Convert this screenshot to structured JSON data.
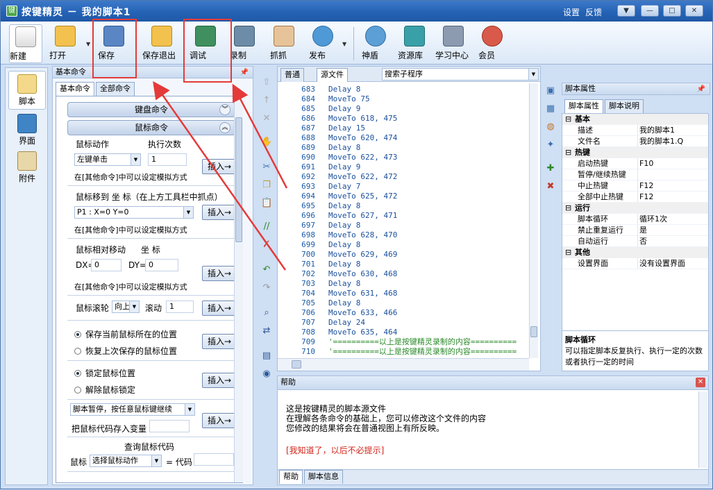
{
  "window": {
    "title": "按键精灵 － 我的脚本1",
    "links": [
      "设置",
      "反馈"
    ]
  },
  "toolbar": {
    "buttons": [
      {
        "label": "新建",
        "icon": "new-icon"
      },
      {
        "label": "打开",
        "icon": "open-icon"
      },
      {
        "label": "保存",
        "icon": "save-icon"
      },
      {
        "label": "保存退出",
        "icon": "save-exit-icon"
      },
      {
        "label": "调试",
        "icon": "debug-icon"
      },
      {
        "label": "录制",
        "icon": "record-icon"
      },
      {
        "label": "抓抓",
        "icon": "grab-icon"
      },
      {
        "label": "发布",
        "icon": "publish-icon"
      },
      {
        "label": "神盾",
        "icon": "shield-icon"
      },
      {
        "label": "资源库",
        "icon": "resource-icon"
      },
      {
        "label": "学习中心",
        "icon": "learning-icon"
      },
      {
        "label": "会员",
        "icon": "member-icon"
      }
    ]
  },
  "leftnav": [
    {
      "label": "脚本"
    },
    {
      "label": "界面"
    },
    {
      "label": "附件"
    }
  ],
  "cmdpanel": {
    "header": "基本命令",
    "tabs": [
      "基本命令",
      "全部命令"
    ],
    "groups": [
      "键盘命令",
      "鼠标命令"
    ],
    "mouse_action": {
      "label": "鼠标动作",
      "count_label": "执行次数",
      "action_value": "左键单击",
      "count_value": "1",
      "note": "在[其他命令]中可以设定模拟方式",
      "insert": "插入→"
    },
    "mouse_move": {
      "label": "鼠标移到 坐 标（在上方工具栏中抓点）",
      "value": "P1 : X=0 Y=0",
      "note": "在[其他命令]中可以设定模拟方式",
      "insert": "插入→"
    },
    "relative": {
      "label": "鼠标相对移动",
      "coord_label": "坐 标",
      "dx_label": "DX=",
      "dx": "0",
      "dy_label": "DY=",
      "dy": "0",
      "note": "在[其他命令]中可以设定模拟方式",
      "insert": "插入→"
    },
    "wheel": {
      "label": "鼠标滚轮",
      "dir": "向上",
      "amount_label": "滚动",
      "amount": "1",
      "insert": "插入→"
    },
    "save_pos": {
      "opt1": "保存当前鼠标所在的位置",
      "opt2": "恢复上次保存的鼠标位置",
      "insert": "插入→"
    },
    "lock": {
      "opt1": "锁定鼠标位置",
      "opt2": "解除鼠标锁定",
      "insert": "插入→"
    },
    "pause": {
      "value": "脚本暂停，按任意鼠标键继续",
      "var_label": "把鼠标代码存入变量",
      "insert": "插入→"
    },
    "query": {
      "title": "查询鼠标代码",
      "label": "鼠标",
      "value": "选择鼠标动作",
      "eq": "= 代码"
    }
  },
  "editor": {
    "tabs": [
      "普通",
      "源文件"
    ],
    "search_placeholder": "搜索子程序",
    "lines": [
      {
        "n": "683",
        "t": "Delay 8"
      },
      {
        "n": "684",
        "t": "MoveTo 75"
      },
      {
        "n": "685",
        "t": "Delay 9"
      },
      {
        "n": "686",
        "t": "MoveTo 618, 475"
      },
      {
        "n": "687",
        "t": "Delay 15"
      },
      {
        "n": "688",
        "t": "MoveTo 620, 474"
      },
      {
        "n": "689",
        "t": "Delay 8"
      },
      {
        "n": "690",
        "t": "MoveTo 622, 473"
      },
      {
        "n": "691",
        "t": "Delay 9"
      },
      {
        "n": "692",
        "t": "MoveTo 622, 472"
      },
      {
        "n": "693",
        "t": "Delay 7"
      },
      {
        "n": "694",
        "t": "MoveTo 625, 472"
      },
      {
        "n": "695",
        "t": "Delay 8"
      },
      {
        "n": "696",
        "t": "MoveTo 627, 471"
      },
      {
        "n": "697",
        "t": "Delay 8"
      },
      {
        "n": "698",
        "t": "MoveTo 628, 470"
      },
      {
        "n": "699",
        "t": "Delay 8"
      },
      {
        "n": "700",
        "t": "MoveTo 629, 469"
      },
      {
        "n": "701",
        "t": "Delay 8"
      },
      {
        "n": "702",
        "t": "MoveTo 630, 468"
      },
      {
        "n": "703",
        "t": "Delay 8"
      },
      {
        "n": "704",
        "t": "MoveTo 631, 468"
      },
      {
        "n": "705",
        "t": "Delay 8"
      },
      {
        "n": "706",
        "t": "MoveTo 633, 466"
      },
      {
        "n": "707",
        "t": "Delay 24"
      },
      {
        "n": "708",
        "t": "MoveTo 635, 464"
      },
      {
        "n": "709",
        "t": "'==========以上是按键精灵录制的内容=========="
      },
      {
        "n": "710",
        "t": "'==========以上是按键精灵录制的内容=========="
      }
    ]
  },
  "props": {
    "header": "脚本属性",
    "tabs": [
      "脚本属性",
      "脚本说明"
    ],
    "rows": [
      {
        "cat": "基本"
      },
      {
        "k": "描述",
        "v": "我的脚本1"
      },
      {
        "k": "文件名",
        "v": "我的脚本1.Q"
      },
      {
        "cat": "热键"
      },
      {
        "k": "启动热键",
        "v": "F10"
      },
      {
        "k": "暂停/继续热键",
        "v": ""
      },
      {
        "k": "中止热键",
        "v": "F12"
      },
      {
        "k": "全部中止热键",
        "v": "F12"
      },
      {
        "cat": "运行"
      },
      {
        "k": "脚本循环",
        "v": "循环1次"
      },
      {
        "k": "禁止重复运行",
        "v": "是"
      },
      {
        "k": "自动运行",
        "v": "否"
      },
      {
        "cat": "其他"
      },
      {
        "k": "设置界面",
        "v": "没有设置界面"
      }
    ],
    "desc_title": "脚本循环",
    "desc": "可以指定脚本反复执行、执行一定的次数或者执行一定的时间"
  },
  "help": {
    "header": "帮助",
    "lines": [
      "这是按键精灵的脚本源文件",
      "在理解各条命令的基础上，您可以修改这个文件的内容",
      "您修改的结果将会在普通视图上有所反映。"
    ],
    "link": "[我知道了，以后不必提示]",
    "tabs": [
      "帮助",
      "脚本信息"
    ]
  },
  "colors": {
    "accent": "#2563b6",
    "highlight": "#e53a3a"
  }
}
